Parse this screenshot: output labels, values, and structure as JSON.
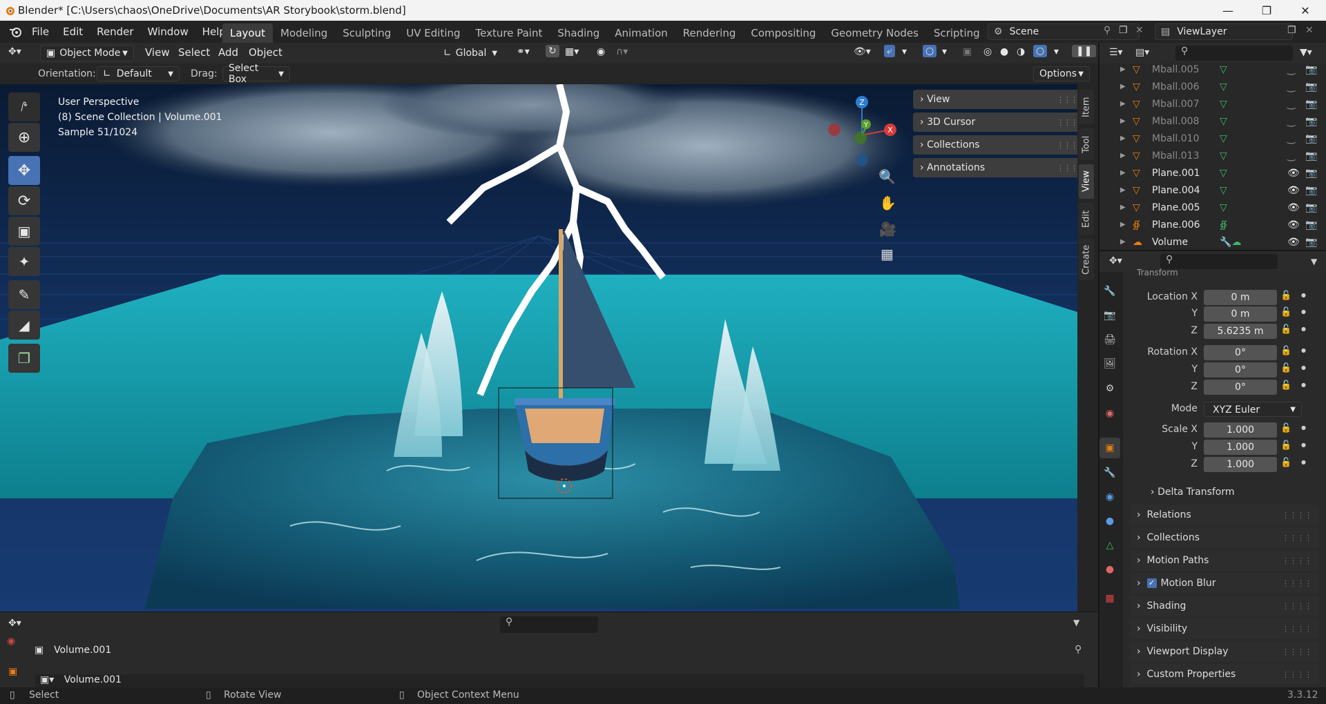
{
  "window": {
    "title": "Blender* [C:\\Users\\chaos\\OneDrive\\Documents\\AR Storybook\\storm.blend]"
  },
  "menus": [
    "File",
    "Edit",
    "Render",
    "Window",
    "Help"
  ],
  "workspaces": [
    "Layout",
    "Modeling",
    "Sculpting",
    "UV Editing",
    "Texture Paint",
    "Shading",
    "Animation",
    "Rendering",
    "Compositing",
    "Geometry Nodes",
    "Scripting"
  ],
  "scene": {
    "name": "Scene",
    "view_layer": "ViewLayer"
  },
  "viewport_header": {
    "mode": "Object Mode",
    "menus": [
      "View",
      "Select",
      "Add",
      "Object"
    ],
    "transform_orientation": "Global",
    "orientation_label": "Orientation:",
    "orientation_value": "Default",
    "drag_label": "Drag:",
    "drag_value": "Select Box",
    "options": "Options"
  },
  "overlay_info": {
    "line1": "User Perspective",
    "line2": "(8) Scene Collection | Volume.001",
    "line3": "Sample 51/1024"
  },
  "npanel": {
    "sections": [
      "View",
      "3D Cursor",
      "Collections",
      "Annotations"
    ],
    "tabs": [
      "Item",
      "Tool",
      "View",
      "Edit",
      "Create"
    ]
  },
  "gizmo": {
    "x": "X",
    "y": "Y",
    "z": "Z"
  },
  "outliner": {
    "items": [
      {
        "name": "Mball.005",
        "dim": true
      },
      {
        "name": "Mball.006",
        "dim": true
      },
      {
        "name": "Mball.007",
        "dim": true
      },
      {
        "name": "Mball.008",
        "dim": true
      },
      {
        "name": "Mball.010",
        "dim": true
      },
      {
        "name": "Mball.013",
        "dim": true
      },
      {
        "name": "Plane.001",
        "dim": false
      },
      {
        "name": "Plane.004",
        "dim": false
      },
      {
        "name": "Plane.005",
        "dim": false
      },
      {
        "name": "Plane.006",
        "dim": false
      },
      {
        "name": "Volume",
        "dim": false
      }
    ]
  },
  "properties": {
    "section_title": "Transform",
    "location": {
      "x_label": "Location X",
      "y_label": "Y",
      "z_label": "Z",
      "x": "0 m",
      "y": "0 m",
      "z": "5.6235 m"
    },
    "rotation": {
      "x_label": "Rotation X",
      "y_label": "Y",
      "z_label": "Z",
      "x": "0°",
      "y": "0°",
      "z": "0°"
    },
    "mode_label": "Mode",
    "mode_value": "XYZ Euler",
    "scale": {
      "x_label": "Scale X",
      "y_label": "Y",
      "z_label": "Z",
      "x": "1.000",
      "y": "1.000",
      "z": "1.000"
    },
    "delta_transform": "Delta Transform",
    "sections": [
      "Relations",
      "Collections",
      "Motion Paths",
      "Motion Blur",
      "Shading",
      "Visibility",
      "Viewport Display",
      "Custom Properties"
    ]
  },
  "bottom_panel": {
    "object_name": "Volume.001",
    "datablock_name": "Volume.001"
  },
  "status_bar": {
    "select": "Select",
    "rotate": "Rotate View",
    "context": "Object Context Menu",
    "version": "3.3.12"
  }
}
